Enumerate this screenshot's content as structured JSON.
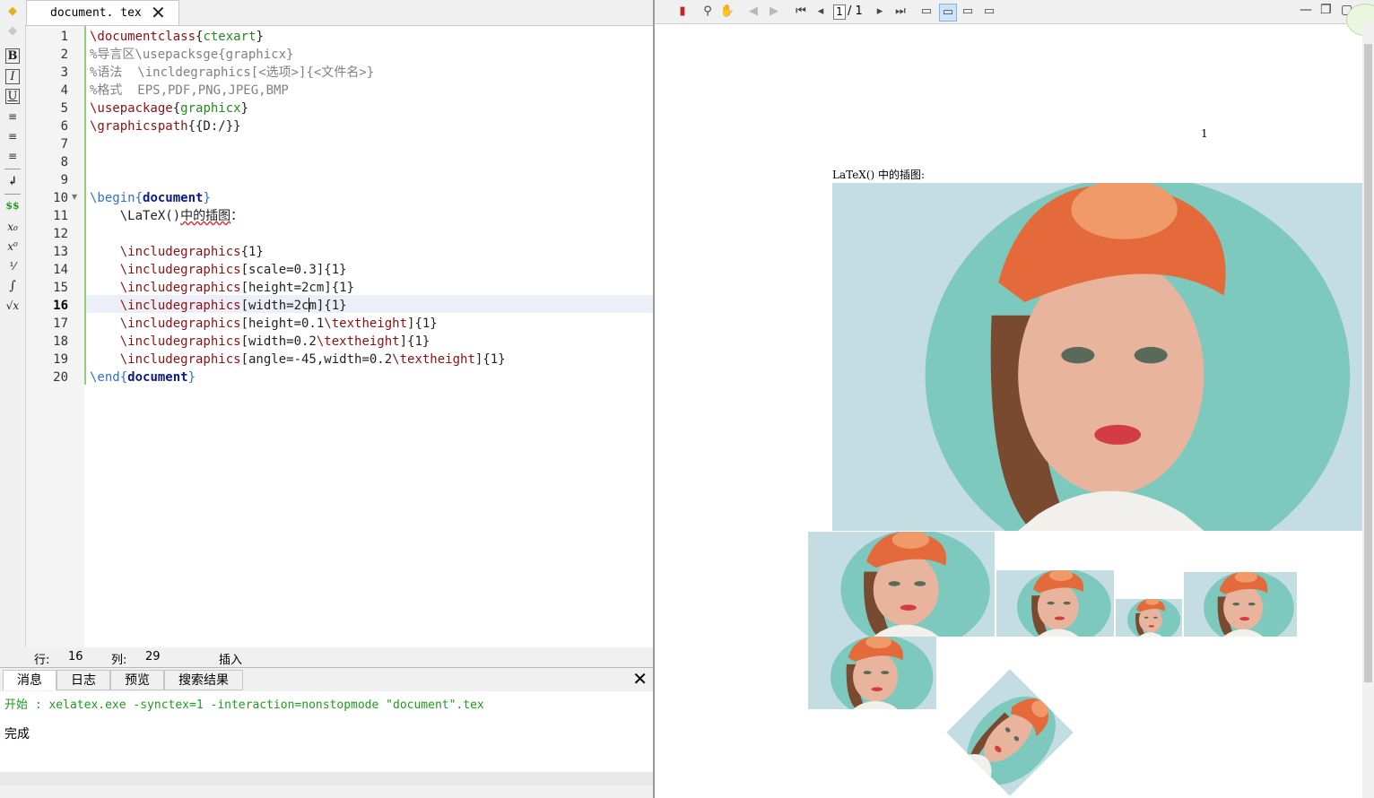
{
  "editor": {
    "tab_label": "document. tex",
    "tab_close": "✕",
    "lines": [
      {
        "n": "1",
        "parts": [
          {
            "t": "\\documentclass",
            "c": "cmd"
          },
          {
            "t": "{",
            "c": ""
          },
          {
            "t": "ctexart",
            "c": "arg"
          },
          {
            "t": "}",
            "c": ""
          }
        ]
      },
      {
        "n": "2",
        "parts": [
          {
            "t": "%导言区\\usepacksge{graphicx}",
            "c": "cmt"
          }
        ]
      },
      {
        "n": "3",
        "parts": [
          {
            "t": "%语法  \\incldegraphics[<选项>]{<文件名>}",
            "c": "cmt"
          }
        ]
      },
      {
        "n": "4",
        "parts": [
          {
            "t": "%格式  EPS,PDF,PNG,JPEG,BMP",
            "c": "cmt"
          }
        ]
      },
      {
        "n": "5",
        "parts": [
          {
            "t": "\\usepackage",
            "c": "cmd"
          },
          {
            "t": "{",
            "c": ""
          },
          {
            "t": "graphicx",
            "c": "arg"
          },
          {
            "t": "}",
            "c": ""
          }
        ]
      },
      {
        "n": "6",
        "parts": [
          {
            "t": "\\graphicspath",
            "c": "cmd"
          },
          {
            "t": "{{D:/}}",
            "c": ""
          }
        ]
      },
      {
        "n": "7",
        "parts": []
      },
      {
        "n": "8",
        "parts": []
      },
      {
        "n": "9",
        "parts": []
      },
      {
        "n": "10",
        "parts": [
          {
            "t": "\\begin",
            "c": "env"
          },
          {
            "t": "{",
            "c": "env"
          },
          {
            "t": "document",
            "c": "envn"
          },
          {
            "t": "}",
            "c": "env"
          }
        ]
      },
      {
        "n": "11",
        "parts": [
          {
            "t": "    \\LaTeX()",
            "c": ""
          },
          {
            "t": "中的插图",
            "c": "squig"
          },
          {
            "t": "：",
            "c": ""
          }
        ]
      },
      {
        "n": "12",
        "parts": []
      },
      {
        "n": "13",
        "parts": [
          {
            "t": "    \\includegraphics",
            "c": "cmd"
          },
          {
            "t": "{1}",
            "c": ""
          }
        ]
      },
      {
        "n": "14",
        "parts": [
          {
            "t": "    \\includegraphics",
            "c": "cmd"
          },
          {
            "t": "[scale=0.3]{1}",
            "c": ""
          }
        ]
      },
      {
        "n": "15",
        "parts": [
          {
            "t": "    \\includegraphics",
            "c": "cmd"
          },
          {
            "t": "[height=2cm]{1}",
            "c": ""
          }
        ]
      },
      {
        "n": "16",
        "parts": [
          {
            "t": "    \\includegraphics",
            "c": "cmd"
          },
          {
            "t": "[width=2c",
            "c": ""
          },
          {
            "t": "|",
            "c": "caret"
          },
          {
            "t": "m]{1}",
            "c": ""
          }
        ]
      },
      {
        "n": "17",
        "parts": [
          {
            "t": "    \\includegraphics",
            "c": "cmd"
          },
          {
            "t": "[height=0.1",
            "c": ""
          },
          {
            "t": "\\textheight",
            "c": "cmd"
          },
          {
            "t": "]{1}",
            "c": ""
          }
        ]
      },
      {
        "n": "18",
        "parts": [
          {
            "t": "    \\includegraphics",
            "c": "cmd"
          },
          {
            "t": "[width=0.2",
            "c": ""
          },
          {
            "t": "\\textheight",
            "c": "cmd"
          },
          {
            "t": "]{1}",
            "c": ""
          }
        ]
      },
      {
        "n": "19",
        "parts": [
          {
            "t": "    \\includegraphics",
            "c": "cmd"
          },
          {
            "t": "[angle=-45,width=0.2",
            "c": ""
          },
          {
            "t": "\\textheight",
            "c": "cmd"
          },
          {
            "t": "]{1}",
            "c": ""
          }
        ]
      },
      {
        "n": "20",
        "parts": [
          {
            "t": "\\end",
            "c": "env"
          },
          {
            "t": "{",
            "c": "env"
          },
          {
            "t": "document",
            "c": "envn"
          },
          {
            "t": "}",
            "c": "env"
          }
        ]
      }
    ],
    "current_line": "16"
  },
  "status": {
    "row_label": "行:",
    "row_value": "16",
    "col_label": "列:",
    "col_value": "29",
    "mode": "插入"
  },
  "messages": {
    "tabs": [
      "消息",
      "日志",
      "预览",
      "搜索结果"
    ],
    "close": "✕",
    "start_line": "开始 : xelatex.exe -synctex=1 -interaction=nonstopmode \"document\".tex",
    "done_line": "完成"
  },
  "sidebar_icons": [
    "back-icon",
    "forward-icon",
    "bold-icon",
    "italic-icon",
    "underline-icon",
    "align-left-icon",
    "align-center-icon",
    "align-right-icon",
    "newline-icon",
    "math-dollar-icon",
    "subscript-icon",
    "superscript-icon",
    "fraction-icon",
    "integral-icon",
    "sqrt-icon"
  ],
  "sidebar_glyphs": [
    "◆",
    "◆",
    "B",
    "I",
    "U",
    "≡",
    "≡",
    "≡",
    "↲",
    "$$",
    "x₀",
    "x⁰",
    "⅟",
    "∫",
    "√x"
  ],
  "pdf": {
    "page_current": "1",
    "page_total": "/ 1",
    "page_number": "1",
    "text_line": "LaTeX() 中的插图:"
  },
  "colors": {
    "photo_bg": "#c4dde3",
    "photo_circle": "#7ec9bd",
    "scarf": "#e46a3c",
    "skin": "#e8b49d",
    "hair": "#7a4a30",
    "lips": "#d43c45"
  }
}
